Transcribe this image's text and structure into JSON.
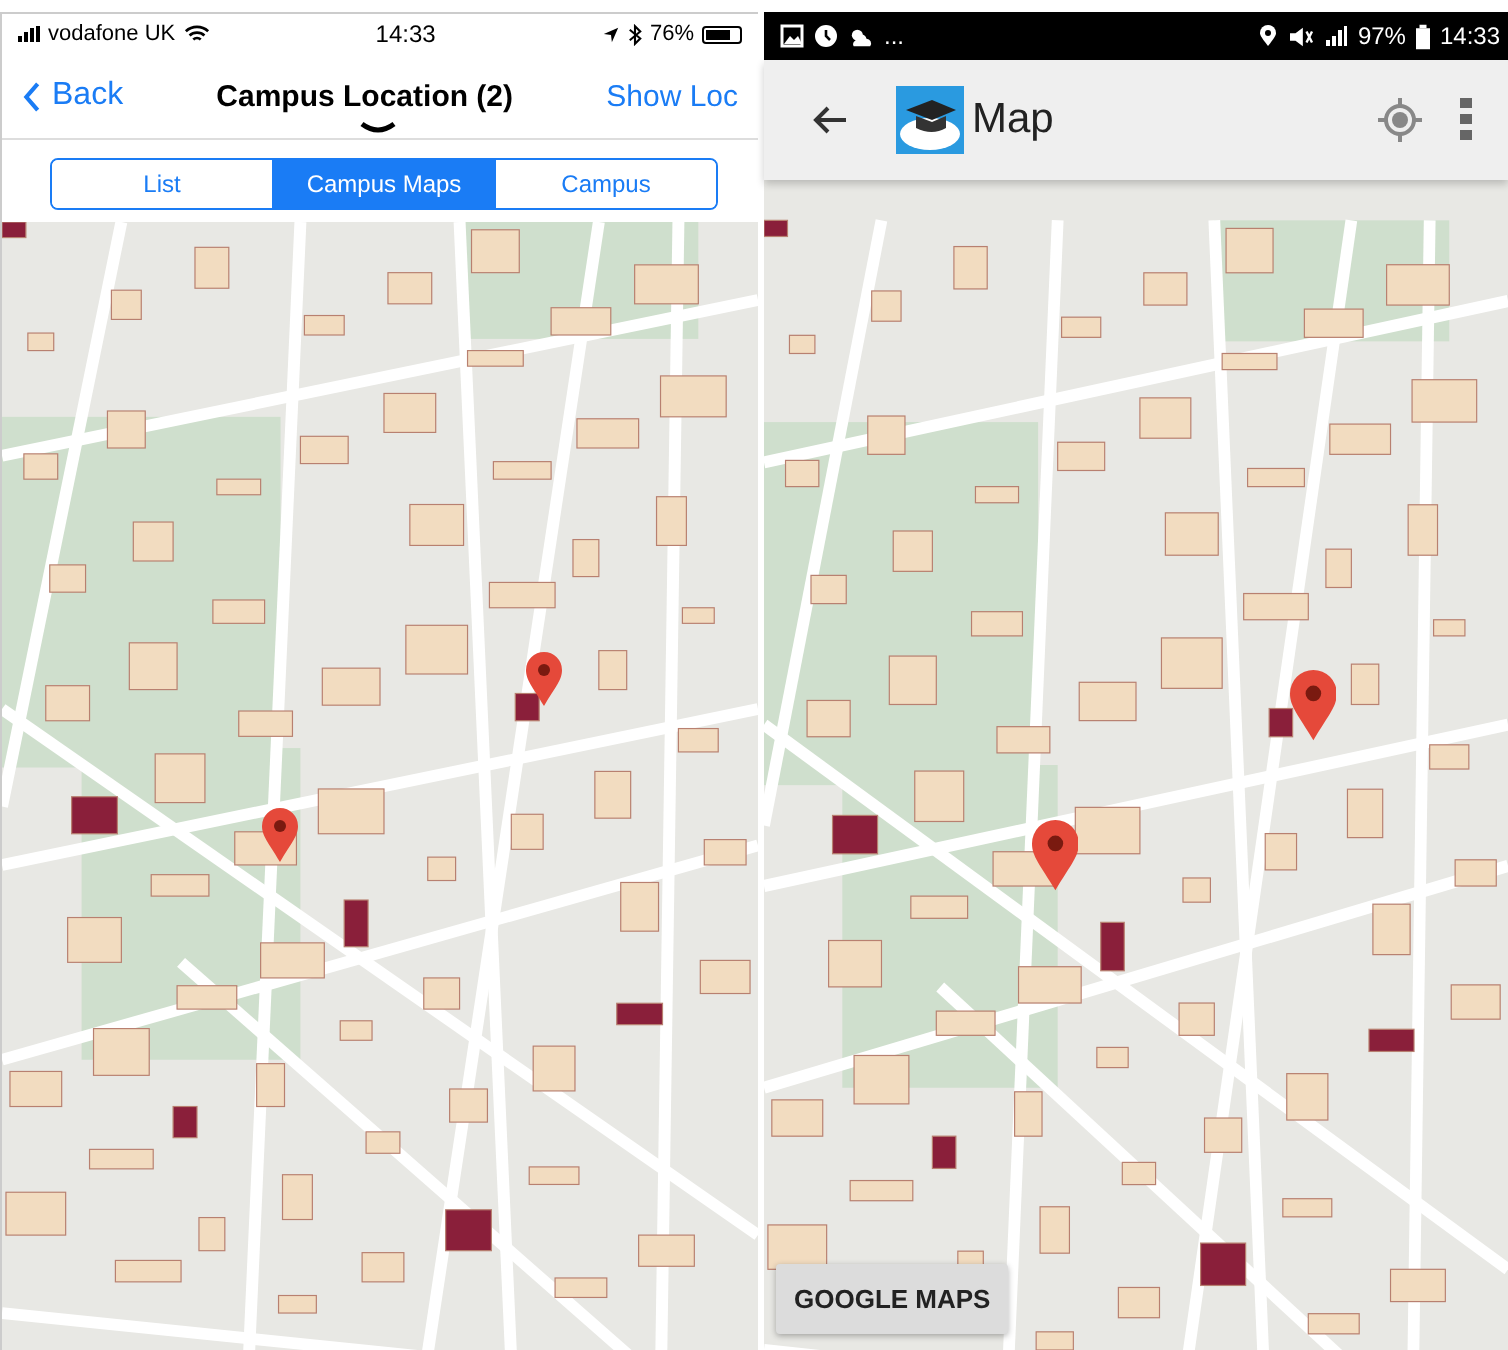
{
  "ios_screen": {
    "status_bar": {
      "carrier": "vodafone UK",
      "time": "14:33",
      "battery": "76%"
    },
    "nav_bar": {
      "back": "Back",
      "title": "Campus Location (2)",
      "action": "Show Loc"
    },
    "segments": [
      {
        "label": "List",
        "selected": false
      },
      {
        "label": "Campus Maps",
        "selected": true
      },
      {
        "label": "Campus",
        "selected": false
      }
    ]
  },
  "android_screen": {
    "status_bar": {
      "more": "...",
      "battery": "97%",
      "time": "14:33"
    },
    "toolbar": {
      "title": "Map"
    },
    "map_button": "GOOGLE MAPS"
  }
}
